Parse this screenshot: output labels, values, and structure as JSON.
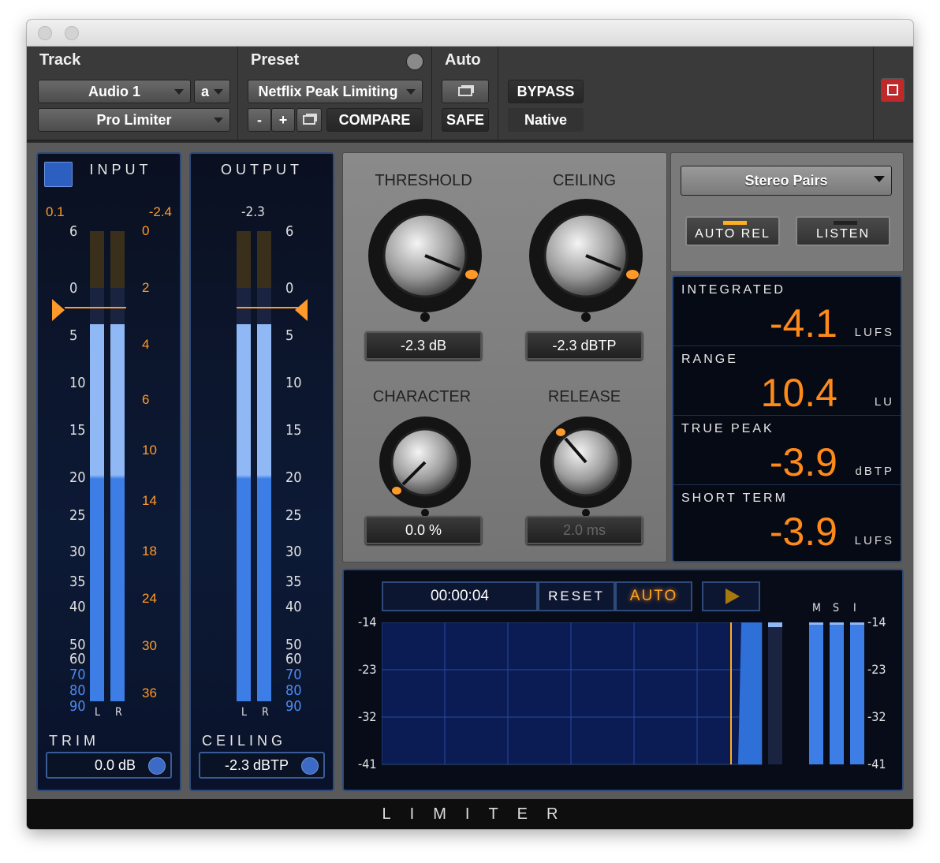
{
  "header": {
    "track_label": "Track",
    "preset_label": "Preset",
    "auto_label": "Auto",
    "track_name": "Audio 1",
    "track_variant": "a",
    "plugin": "Pro Limiter",
    "preset_name": "Netflix Peak Limiting",
    "minus": "-",
    "plus": "+",
    "compare": "COMPARE",
    "safe": "SAFE",
    "bypass": "BYPASS",
    "native": "Native"
  },
  "input": {
    "title": "INPUT",
    "peak_left": "0.1",
    "peak_right": "-2.4",
    "trim_label": "TRIM",
    "trim_value": "0.0 dB",
    "level_left": 0.6,
    "level_right": 0.6
  },
  "output": {
    "title": "OUTPUT",
    "peak": "-2.3",
    "ceiling_label": "CEILING",
    "ceiling_value": "-2.3 dBTP"
  },
  "scale_left": [
    "6",
    "0",
    "5",
    "10",
    "15",
    "20",
    "25",
    "30",
    "35",
    "40",
    "50",
    "60",
    "70",
    "80",
    "90"
  ],
  "scale_red": [
    "0",
    "2",
    "4",
    "6",
    "10",
    "14",
    "18",
    "24",
    "30",
    "36"
  ],
  "channels": {
    "l": "L",
    "r": "R"
  },
  "knobs": {
    "threshold": {
      "label": "THRESHOLD",
      "value": "-2.3 dB"
    },
    "ceiling": {
      "label": "CEILING",
      "value": "-2.3 dBTP"
    },
    "character": {
      "label": "CHARACTER",
      "value": "0.0 %"
    },
    "release": {
      "label": "RELEASE",
      "value": "2.0 ms"
    }
  },
  "right": {
    "mode": "Stereo Pairs",
    "auto_rel": "AUTO REL",
    "listen": "LISTEN"
  },
  "loudness": {
    "integrated": {
      "label": "INTEGRATED",
      "value": "-4.1",
      "unit": "LUFS"
    },
    "range": {
      "label": "RANGE",
      "value": "10.4",
      "unit": "LU"
    },
    "true_peak": {
      "label": "TRUE PEAK",
      "value": "-3.9",
      "unit": "dBTP"
    },
    "short_term": {
      "label": "SHORT TERM",
      "value": "-3.9",
      "unit": "LUFS"
    }
  },
  "history": {
    "time": "00:00:04",
    "reset": "RESET",
    "auto": "AUTO",
    "axis": [
      "-14",
      "-23",
      "-32",
      "-41"
    ],
    "msi": [
      "M",
      "S",
      "I"
    ],
    "axis_right": [
      "-14",
      "-23",
      "-32",
      "-41"
    ]
  },
  "footer": "LIMITER",
  "colors": {
    "accent": "#ff8a1a",
    "meter": "#3d7de6",
    "panel_border": "#2d4a7a"
  }
}
